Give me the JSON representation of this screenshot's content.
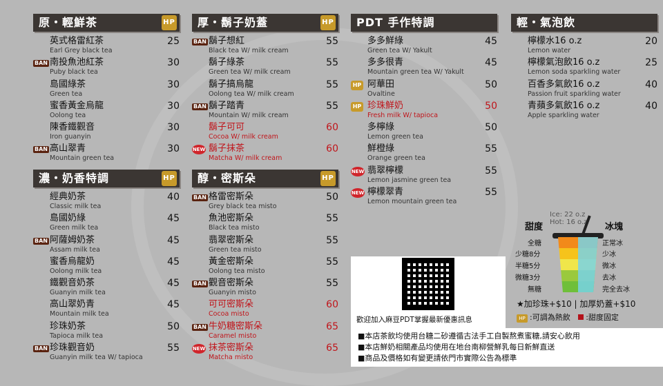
{
  "columns": [
    {
      "sections": [
        {
          "title": "原・輕鮮茶",
          "items": [
            {
              "name": "英式格雷紅茶",
              "eng": "Earl Grey black tea",
              "price": "25",
              "badge": ""
            },
            {
              "name": "南投魚池紅茶",
              "eng": "Puby black tea",
              "price": "30",
              "badge": "BAN"
            },
            {
              "name": "島國綠茶",
              "eng": "Green tea",
              "price": "30",
              "badge": ""
            },
            {
              "name": "蜜香黃金烏龍",
              "eng": "Oolong tea",
              "price": "30",
              "badge": ""
            },
            {
              "name": "陳香鐵觀音",
              "eng": "Iron guanyin",
              "price": "30",
              "badge": ""
            },
            {
              "name": "高山翠青",
              "eng": "Mountain green tea",
              "price": "30",
              "badge": "BAN"
            }
          ]
        },
        {
          "title": "濃・奶香特調",
          "items": [
            {
              "name": "經典奶茶",
              "eng": "Classic milk tea",
              "price": "40",
              "badge": ""
            },
            {
              "name": "島國奶綠",
              "eng": "Green milk tea",
              "price": "45",
              "badge": ""
            },
            {
              "name": "阿薩姆奶茶",
              "eng": "Assam milk tea",
              "price": "45",
              "badge": "BAN"
            },
            {
              "name": "蜜香烏龍奶",
              "eng": "Oolong milk tea",
              "price": "45",
              "badge": ""
            },
            {
              "name": "鐵觀音奶茶",
              "eng": "Guanyin milk tea",
              "price": "45",
              "badge": ""
            },
            {
              "name": "高山翠奶青",
              "eng": "Mountain milk tea",
              "price": "45",
              "badge": ""
            },
            {
              "name": "珍珠奶茶",
              "eng": "Tapioca milk tea",
              "price": "50",
              "badge": ""
            },
            {
              "name": "珍珠觀音奶",
              "eng": "Guanyin milk tea W/ tapioca",
              "price": "55",
              "badge": "BAN"
            }
          ]
        }
      ]
    },
    {
      "sections": [
        {
          "title": "厚・鬍子奶蓋",
          "items": [
            {
              "name": "鬍子想紅",
              "eng": "Black tea W/ milk cream",
              "price": "55",
              "badge": "BAN"
            },
            {
              "name": "鬍子綠茶",
              "eng": "Green tea W/ milk cream",
              "price": "55",
              "badge": ""
            },
            {
              "name": "鬍子搞烏龍",
              "eng": "Oolong tea W/ milk cream",
              "price": "55",
              "badge": ""
            },
            {
              "name": "鬍子踏青",
              "eng": "Mountain W/ milk cream",
              "price": "55",
              "badge": "BAN"
            },
            {
              "name": "鬍子可可",
              "eng": "Cocoa W/ milk cream",
              "price": "60",
              "badge": "",
              "red": true
            },
            {
              "name": "鬍子抹茶",
              "eng": "Matcha W/ milk cream",
              "price": "60",
              "badge": "NEW",
              "red": true
            }
          ]
        },
        {
          "title": "醇・密斯朵",
          "items": [
            {
              "name": "格雷密斯朵",
              "eng": "Grey black tea misto",
              "price": "50",
              "badge": "BAN"
            },
            {
              "name": "魚池密斯朵",
              "eng": "Black tea misto",
              "price": "55",
              "badge": ""
            },
            {
              "name": "翡翠密斯朵",
              "eng": "Green tea misto",
              "price": "55",
              "badge": ""
            },
            {
              "name": "黃金密斯朵",
              "eng": "Oolong tea misto",
              "price": "55",
              "badge": ""
            },
            {
              "name": "觀音密斯朵",
              "eng": "Guanyin misto",
              "price": "55",
              "badge": "BAN"
            },
            {
              "name": "可可密斯朵",
              "eng": "Cocoa misto",
              "price": "60",
              "badge": "",
              "red": true
            },
            {
              "name": "牛奶糖密斯朵",
              "eng": "Caramel misto",
              "price": "65",
              "badge": "BAN",
              "red": true
            },
            {
              "name": "抹茶密斯朵",
              "eng": "Matcha misto",
              "price": "65",
              "badge": "NEW",
              "red": true
            }
          ]
        }
      ]
    },
    {
      "sections": [
        {
          "title": "PDT 手作特調",
          "items": [
            {
              "name": "多多鮮綠",
              "eng": "Green tea W/ Yakult",
              "price": "45",
              "badge": ""
            },
            {
              "name": "多多很青",
              "eng": "Mountain green tea W/ Yakult",
              "price": "45",
              "badge": ""
            },
            {
              "name": "阿華田",
              "eng": "Ovaltine",
              "price": "50",
              "badge": "HP"
            },
            {
              "name": "珍珠鮮奶",
              "eng": "Fresh milk W/ tapioca",
              "price": "50",
              "badge": "HP",
              "red": true
            },
            {
              "name": "多檸綠",
              "eng": "Lemon green tea",
              "price": "50",
              "badge": ""
            },
            {
              "name": "鮮橙綠",
              "eng": "Orange green tea",
              "price": "55",
              "badge": ""
            },
            {
              "name": "翡翠檸檬",
              "eng": "Lemon jasmine green tea",
              "price": "55",
              "badge": "NEW"
            },
            {
              "name": "檸檬翠青",
              "eng": "Lemon mountain green tea",
              "price": "55",
              "badge": "NEW"
            }
          ]
        }
      ]
    },
    {
      "sections": [
        {
          "title": "輕・氣泡飲",
          "items": [
            {
              "name": "檸檬水16 o.z",
              "eng": "Lemon water",
              "price": "20",
              "badge": ""
            },
            {
              "name": "檸檬氣泡飲16 o.z",
              "eng": "Lemon soda sparkling water",
              "price": "25",
              "badge": ""
            },
            {
              "name": "百香多氣飲16 o.z",
              "eng": "Passion fruit sparkling water",
              "price": "40",
              "badge": ""
            },
            {
              "name": "青蘋多氣飲16 o.z",
              "eng": "Apple sparkling water",
              "price": "40",
              "badge": ""
            }
          ]
        }
      ]
    }
  ],
  "qr_caption": "歡迎加入麻豆PDT掌握最新優惠訊息",
  "notes": [
    "■本店茶飲均使用台糖二砂遵循古法手工自製熬煮蜜糖,請安心飲用",
    "■本店鮮奶相關產品均使用在地台南柳營鮮乳每日新鮮直送",
    "■商品及價格如有變更請依門市實際公告為標準"
  ],
  "guide": {
    "sweet_label": "甜度",
    "ice_label": "冰塊",
    "size_note": [
      "Ice: 22 o.z",
      "Hot: 16 o.z"
    ],
    "sweet_levels": [
      "全糖",
      "少糖8分",
      "半糖5分",
      "微糖3分",
      "無糖"
    ],
    "ice_levels": [
      "正常冰",
      "少冰",
      "微冰",
      "去冰",
      "完全去冰"
    ],
    "addons": "★加珍珠+$10 | 加厚奶蓋+$10",
    "legend_hot": ":可調為熱飲",
    "legend_fixed": ":甜度固定",
    "hp_icon_text": "HP"
  }
}
